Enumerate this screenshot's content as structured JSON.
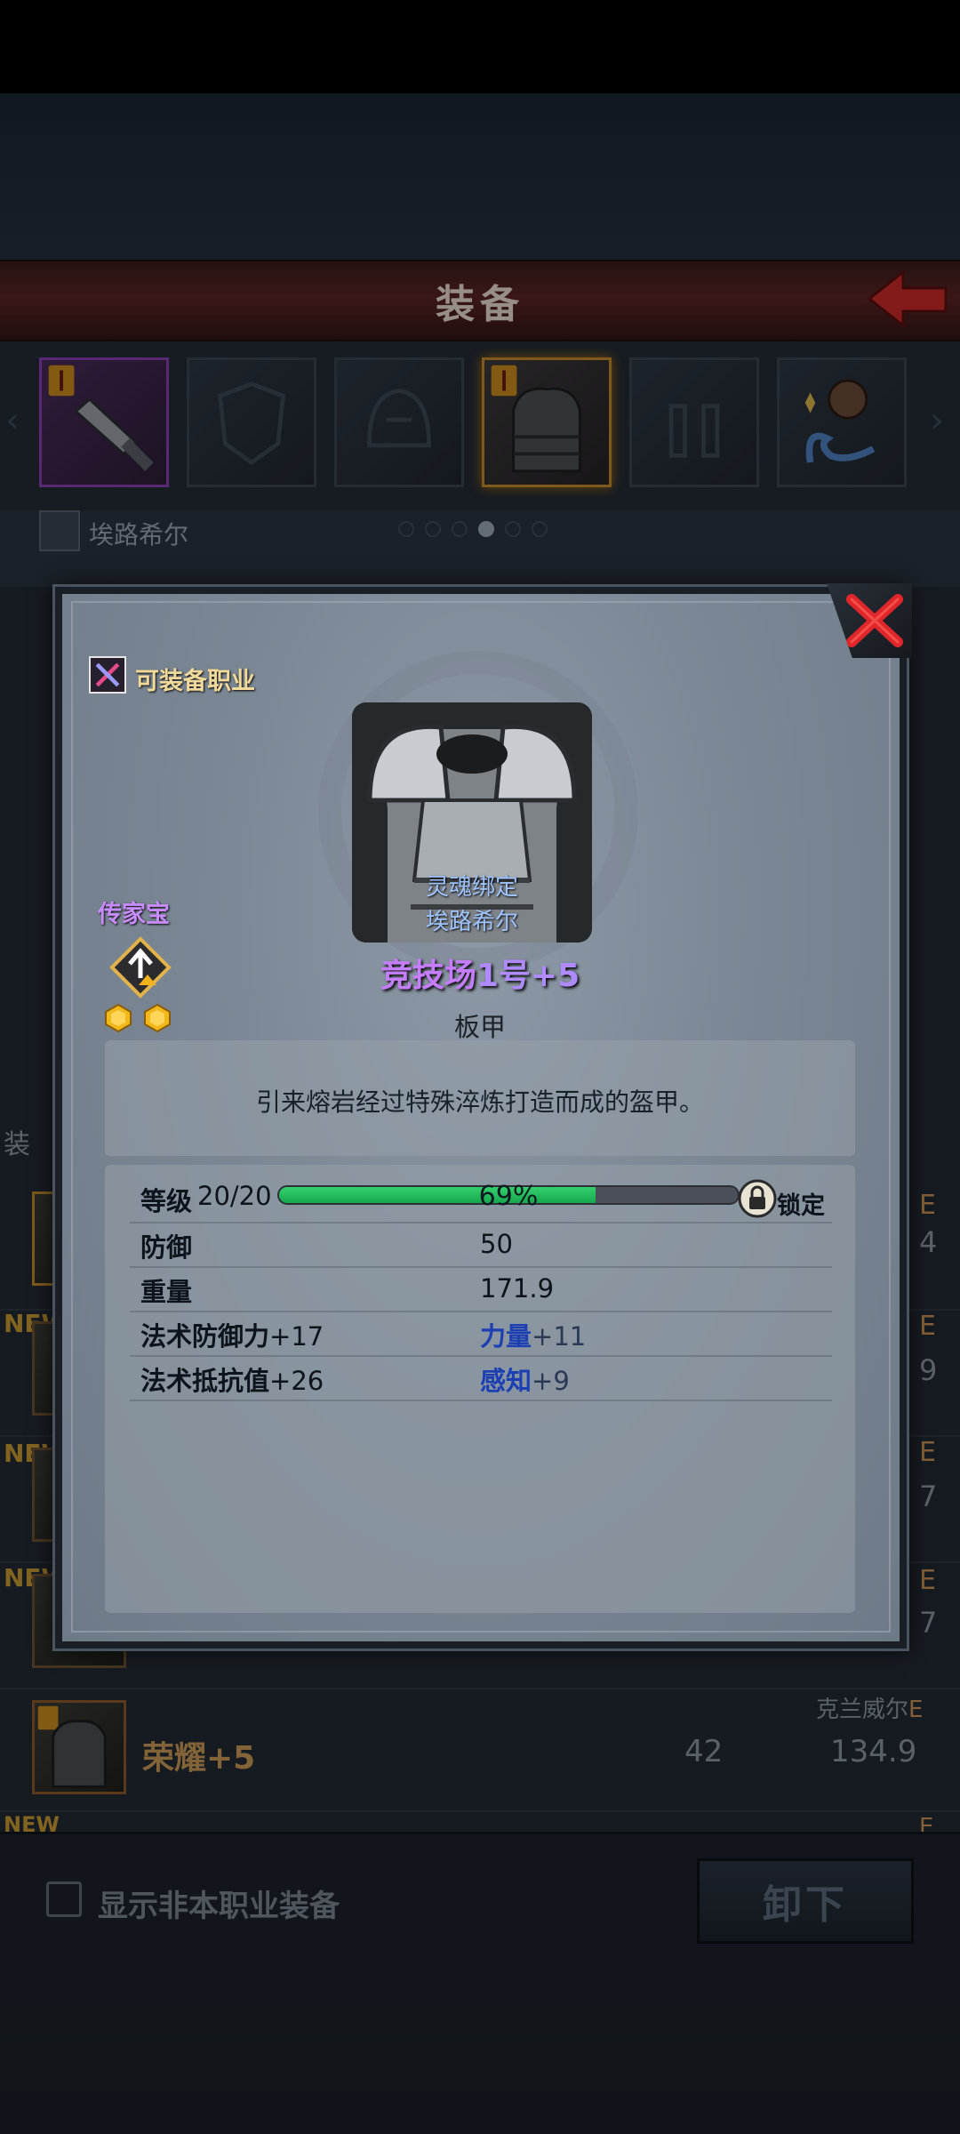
{
  "screen": {
    "title": "装备",
    "owner_name": "埃路希尔",
    "page_dots_total": 6,
    "page_dots_active": 4
  },
  "background_list": [
    {
      "new": "",
      "name": "荣耀+5",
      "value1": "42",
      "value2": "134.9",
      "owner": "克兰威尔",
      "grade": "E"
    }
  ],
  "background_partial": {
    "list_header_char": "装",
    "new_tag": "NEW",
    "right_grades": [
      "E",
      "E",
      "E",
      "E",
      "E"
    ],
    "right_digits": [
      "4",
      "9",
      "7",
      "7"
    ]
  },
  "bottom_bar": {
    "checkbox_label": "显示非本职业装备",
    "unequip_label": "卸下"
  },
  "popup": {
    "class_label": "可装备职业",
    "soulbound_line1": "灵魂绑定",
    "soulbound_line2": "埃路希尔",
    "item_name_base": "竞技场",
    "item_name_num": "1号+5",
    "item_type": "板甲",
    "heirloom_label": "传家宝",
    "description": "引来熔岩经过特殊淬炼打造而成的盔甲。",
    "level_label": "等级",
    "level_value": "20/20",
    "xp_percent_text": "69%",
    "xp_fraction": 0.69,
    "lock_label": "锁定",
    "stats": {
      "defense_label": "防御",
      "defense_value": "50",
      "weight_label": "重量",
      "weight_value": "171.9",
      "mdef_label": "法术防御力",
      "mdef_value": "+17",
      "str_label": "力量",
      "str_value": "+11",
      "mres_label": "法术抵抗值",
      "mres_value": "+26",
      "wis_label": "感知",
      "wis_value": "+9"
    }
  },
  "colors": {
    "xp_fill": "#1fb857",
    "legendary_purple": "#c77dff",
    "soulbound_blue": "#9fc4ff",
    "close_red": "#e0262b"
  },
  "icons": [
    "back-arrow-icon",
    "close-icon",
    "class-icon",
    "heirloom-icon",
    "lock-icon",
    "hex-gem-icon"
  ]
}
